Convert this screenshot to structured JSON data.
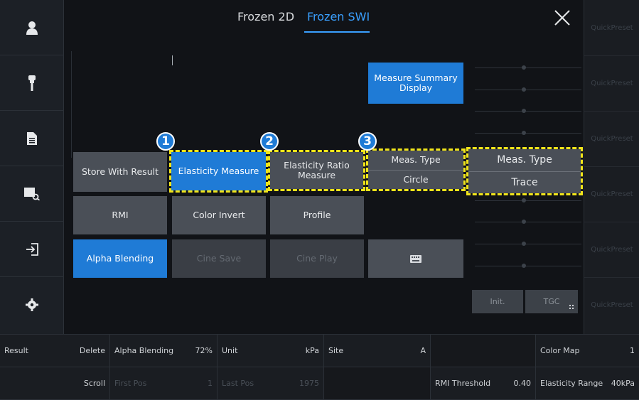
{
  "header": {
    "tabs": [
      "Frozen 2D",
      "Frozen SWI"
    ],
    "active_tab": "Frozen SWI"
  },
  "sidebar": {
    "icons": [
      "user-icon",
      "probe-icon",
      "document-icon",
      "review-icon",
      "exit-icon",
      "settings-icon"
    ]
  },
  "quick_presets": [
    "QuickPreset",
    "QuickPreset",
    "QuickPreset",
    "QuickPreset",
    "QuickPreset",
    "QuickPreset"
  ],
  "buttons": {
    "measure_summary": "Measure Summary Display",
    "store_with_result": "Store With Result",
    "elasticity_measure": "Elasticity Measure",
    "elasticity_ratio": "Elasticity Ratio Measure",
    "meas_type_label": "Meas. Type",
    "meas_type_small_value": "Circle",
    "meas_type_large_label": "Meas. Type",
    "meas_type_large_value": "Trace",
    "rmi": "RMI",
    "color_invert": "Color Invert",
    "profile": "Profile",
    "alpha_blending": "Alpha Blending",
    "cine_save": "Cine Save",
    "cine_play": "Cine Play",
    "init": "Init.",
    "tgc": "TGC"
  },
  "badges": [
    "1",
    "2",
    "3"
  ],
  "bottom_bar": {
    "row1": [
      {
        "label": "Result",
        "value": "Delete"
      },
      {
        "label": "Alpha Blending",
        "value": "72%"
      },
      {
        "label": "Unit",
        "value": "kPa"
      },
      {
        "label": "Site",
        "value": "A"
      },
      {
        "label": "",
        "value": ""
      },
      {
        "label": "Color Map",
        "value": "1"
      }
    ],
    "row2": [
      {
        "label": "",
        "value": "Scroll"
      },
      {
        "label": "First Pos",
        "value": "1"
      },
      {
        "label": "Last Pos",
        "value": "1975"
      },
      {
        "label": "",
        "value": ""
      },
      {
        "label": "RMI Threshold",
        "value": "0.40"
      },
      {
        "label": "Elasticity Range",
        "value": "40kPa"
      }
    ]
  }
}
